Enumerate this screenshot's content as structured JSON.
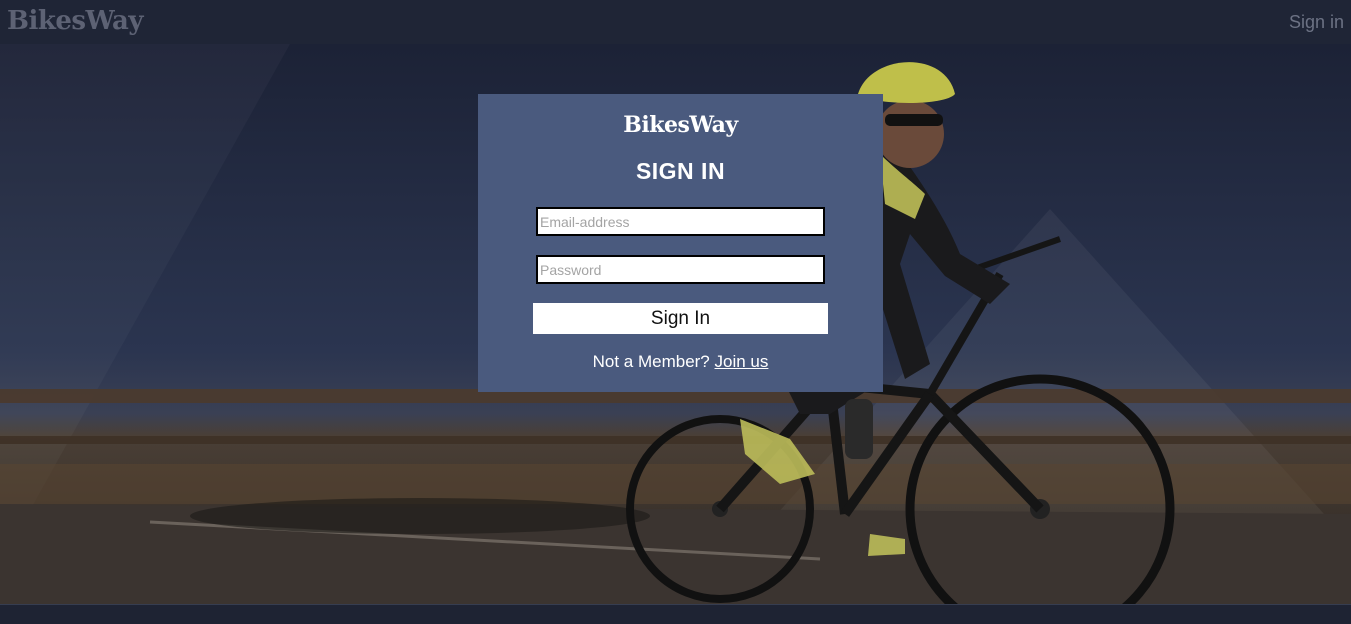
{
  "app": {
    "brand": "BikesWay"
  },
  "header": {
    "brand": "BikesWay",
    "signin_link": "Sign in"
  },
  "login_card": {
    "brand": "BikesWay",
    "title": "SIGN IN",
    "email_placeholder": "Email-address",
    "password_placeholder": "Password",
    "submit_label": "Sign In",
    "member_prompt": "Not a Member?",
    "join_link": "Join us"
  },
  "colors": {
    "header_bg": "#1f2536",
    "card_bg": "#4a5a7e",
    "page_bg": "#1e2333",
    "brand_text": "#5d6274"
  }
}
